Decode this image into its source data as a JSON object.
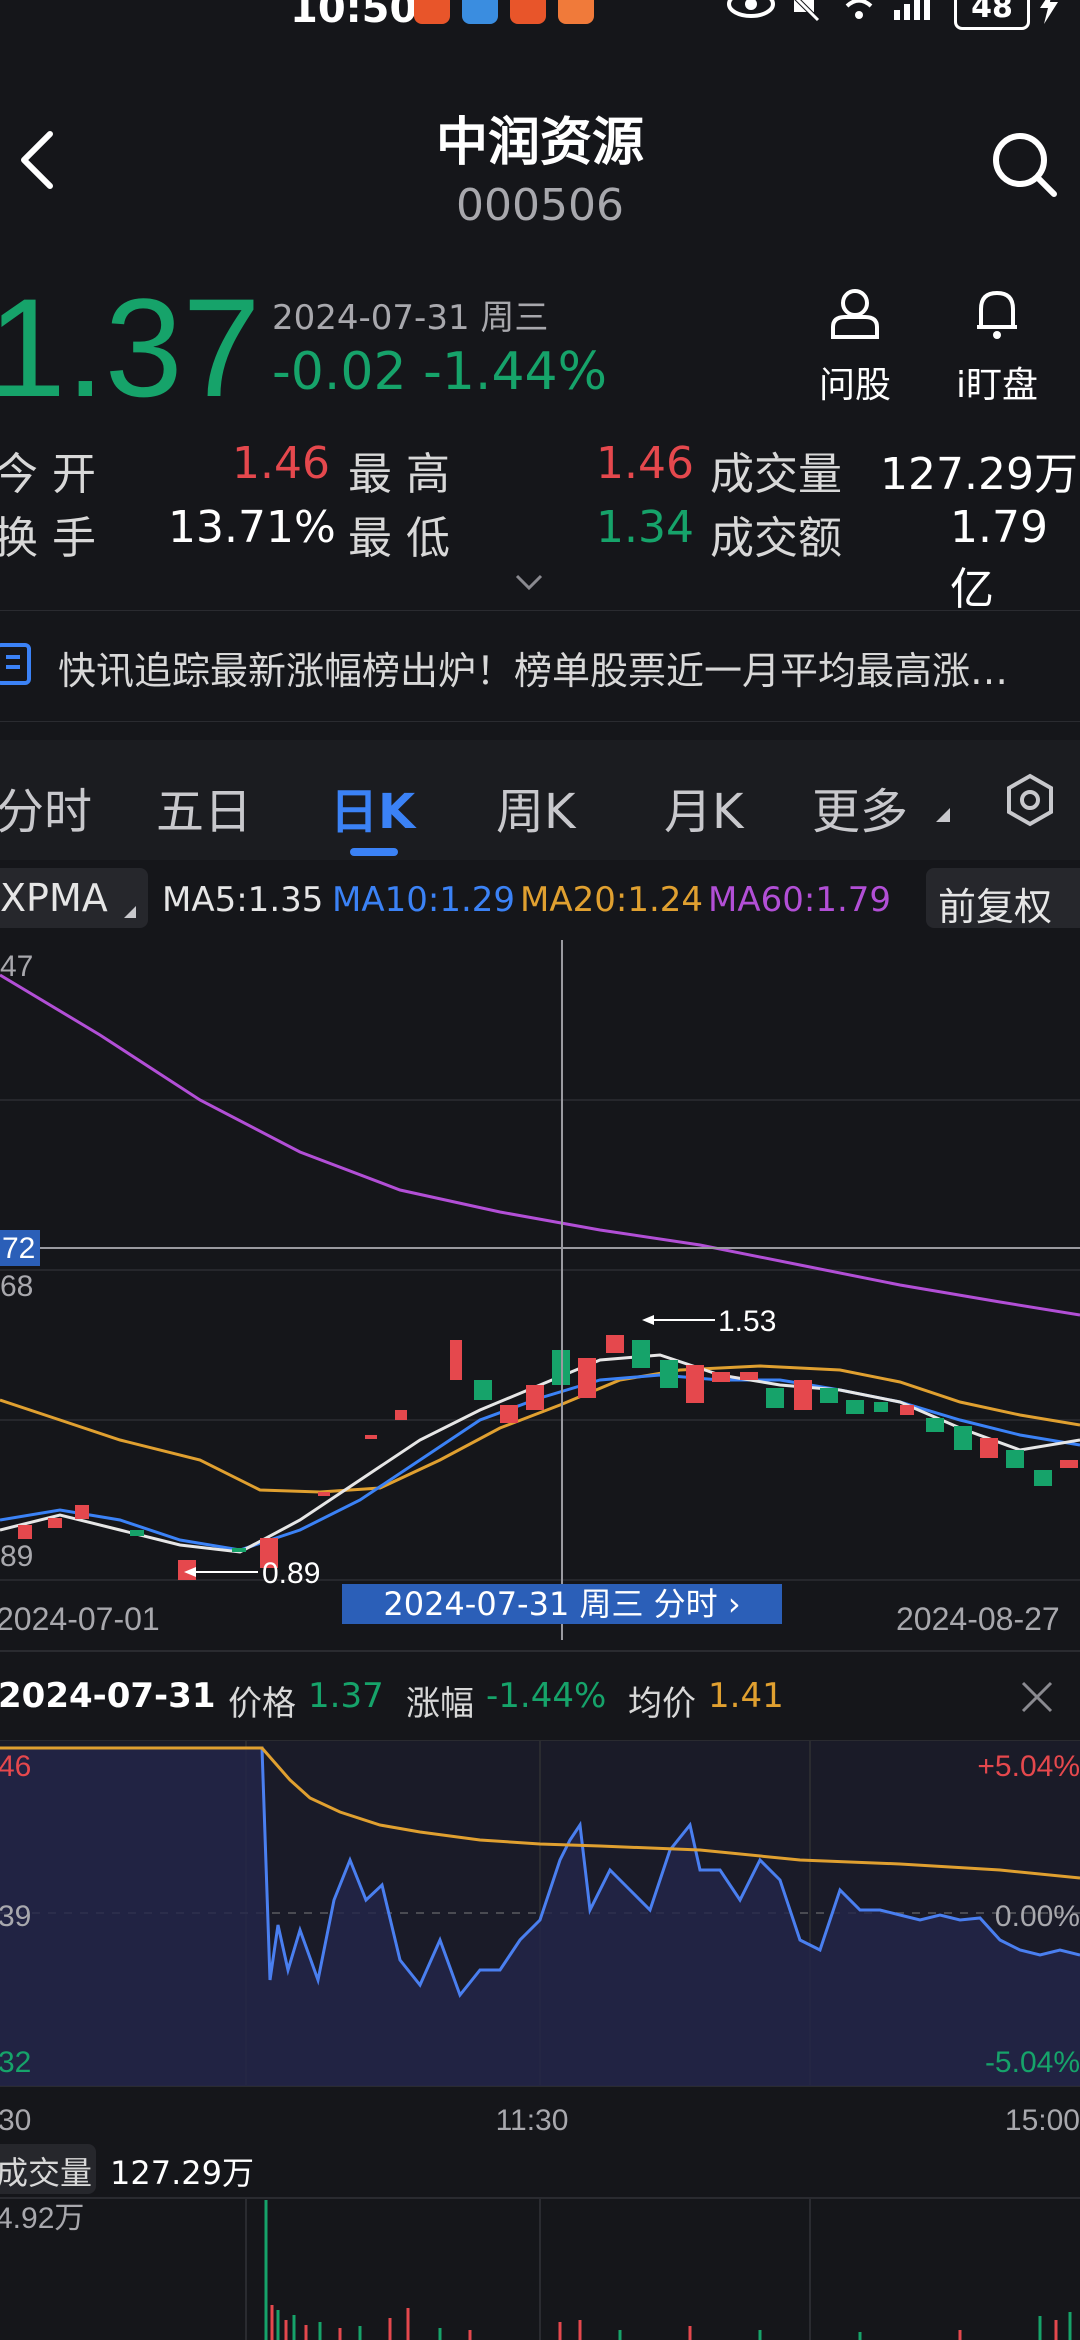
{
  "status": {
    "time": "10:50",
    "battery": "48"
  },
  "header": {
    "title": "中润资源",
    "code": "000506"
  },
  "quote": {
    "price": "1.37",
    "date": "2024-07-31 周三",
    "change": "-0.02",
    "change_pct": "-1.44%"
  },
  "actions": [
    {
      "label": "问股"
    },
    {
      "label": "i盯盘"
    }
  ],
  "stats": {
    "open_label": "今 开",
    "open": "1.46",
    "high_label": "最 高",
    "high": "1.46",
    "volume_label": "成交量",
    "volume": "127.29万",
    "turnover_label": "换 手",
    "turnover": "13.71%",
    "low_label": "最 低",
    "low": "1.34",
    "amount_label": "成交额",
    "amount": "1.79亿"
  },
  "news": {
    "text": "快讯追踪最新涨幅榜出炉！榜单股票近一月平均最高涨…"
  },
  "tabs": [
    {
      "label": "分时"
    },
    {
      "label": "五日"
    },
    {
      "label": "日K"
    },
    {
      "label": "周K"
    },
    {
      "label": "月K"
    },
    {
      "label": "更多"
    }
  ],
  "ma": {
    "type": "XPMA",
    "ma5": "MA5:1.35",
    "ma10": "MA10:1.29",
    "ma20": "MA20:1.24",
    "ma60": "MA60:1.79",
    "adjust": "前复权",
    "colors": {
      "ma5": "#e6e6e6",
      "ma10": "#3b82f6",
      "ma20": "#e0a030",
      "ma60": "#b24fd6"
    }
  },
  "kline": {
    "top_label": "47",
    "cross_label": "72",
    "mid_label": "68",
    "low_label": "89",
    "max_marker": "1.53",
    "min_marker": "0.89",
    "date_left": "2024-07-01",
    "date_right": "2024-08-27",
    "date_banner": "2024-07-31 周三 分时 ›"
  },
  "chart_data": {
    "type": "line",
    "title": "",
    "series": [
      {
        "name": "MA60",
        "values": [
          1.79
        ]
      },
      {
        "name": "MA20",
        "values": [
          1.24
        ]
      },
      {
        "name": "MA10",
        "values": [
          1.29
        ]
      },
      {
        "name": "MA5",
        "values": [
          1.35
        ]
      }
    ]
  },
  "intraday": {
    "date": "2024-07-31",
    "price_label": "价格",
    "price": "1.37",
    "pct_label": "涨幅",
    "pct": "-1.44%",
    "avg_label": "均价",
    "avg": "1.41",
    "left_top": "46",
    "left_mid": "39",
    "left_bot": "32",
    "right_top": "+5.04%",
    "right_mid": "0.00%",
    "right_bot": "-5.04%",
    "t_left": "30",
    "t_mid": "11:30",
    "t_right": "15:00"
  },
  "volume": {
    "label": "成交量",
    "value": "127.29万",
    "axis": "4.92万"
  }
}
